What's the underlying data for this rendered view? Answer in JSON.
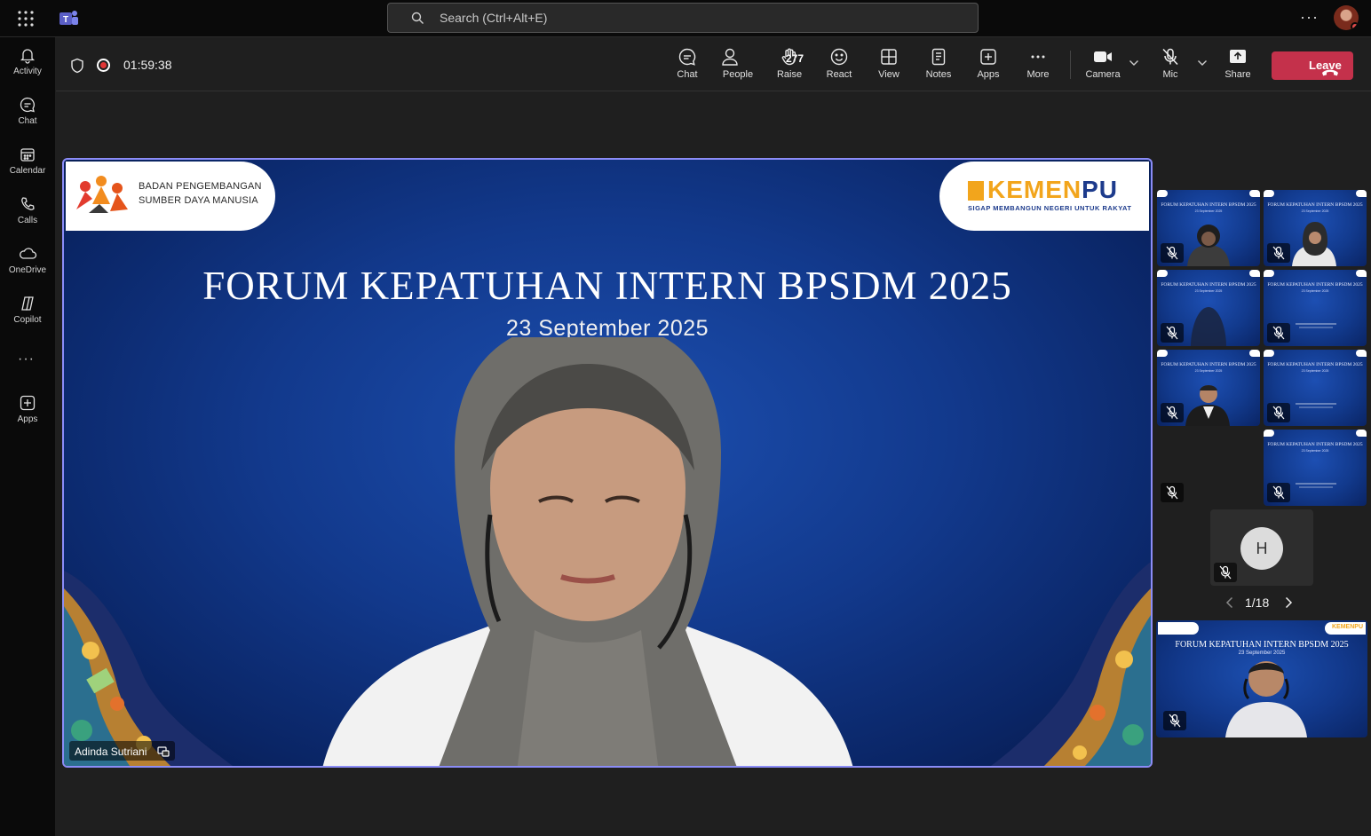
{
  "topbar": {
    "search_placeholder": "Search (Ctrl+Alt+E)",
    "more_label": "···"
  },
  "rail": {
    "items": [
      {
        "label": "Activity"
      },
      {
        "label": "Chat"
      },
      {
        "label": "Calendar"
      },
      {
        "label": "Calls"
      },
      {
        "label": "OneDrive"
      },
      {
        "label": "Copilot"
      },
      {
        "label": "Apps"
      }
    ],
    "more_label": "···"
  },
  "meeting": {
    "timer": "01:59:38",
    "people_count": "277",
    "controls": {
      "chat": "Chat",
      "people": "People",
      "raise": "Raise",
      "react": "React",
      "view": "View",
      "notes": "Notes",
      "apps": "Apps",
      "more": "More",
      "camera": "Camera",
      "mic": "Mic",
      "share": "Share"
    },
    "leave_label": "Leave"
  },
  "stage": {
    "logo_left_line1": "BADAN PENGEMBANGAN",
    "logo_left_line2": "SUMBER DAYA MANUSIA",
    "logo_right_name_a": "KEMEN",
    "logo_right_name_b": "PU",
    "logo_right_tagline": "SIGAP MEMBANGUN NEGERI UNTUK RAKYAT",
    "slide_title": "FORUM KEPATUHAN INTERN BPSDM 2025",
    "slide_date": "23 September 2025",
    "speaker_name": "Adinda Sutriani"
  },
  "gallery": {
    "tile_title": "FORUM KEPATUHAN INTERN BPSDM 2025",
    "tile_date": "23 September 2025",
    "h_initial": "H",
    "page_indicator": "1/18",
    "self_logo": "KEMENPU"
  },
  "colors": {
    "accent_border": "#8b8cf7",
    "leave_red": "#c4314b",
    "rec_red": "#e03636",
    "slide_blue": "#12398c",
    "kemen_gold": "#f2a51c",
    "pu_navy": "#1d3b8c"
  }
}
